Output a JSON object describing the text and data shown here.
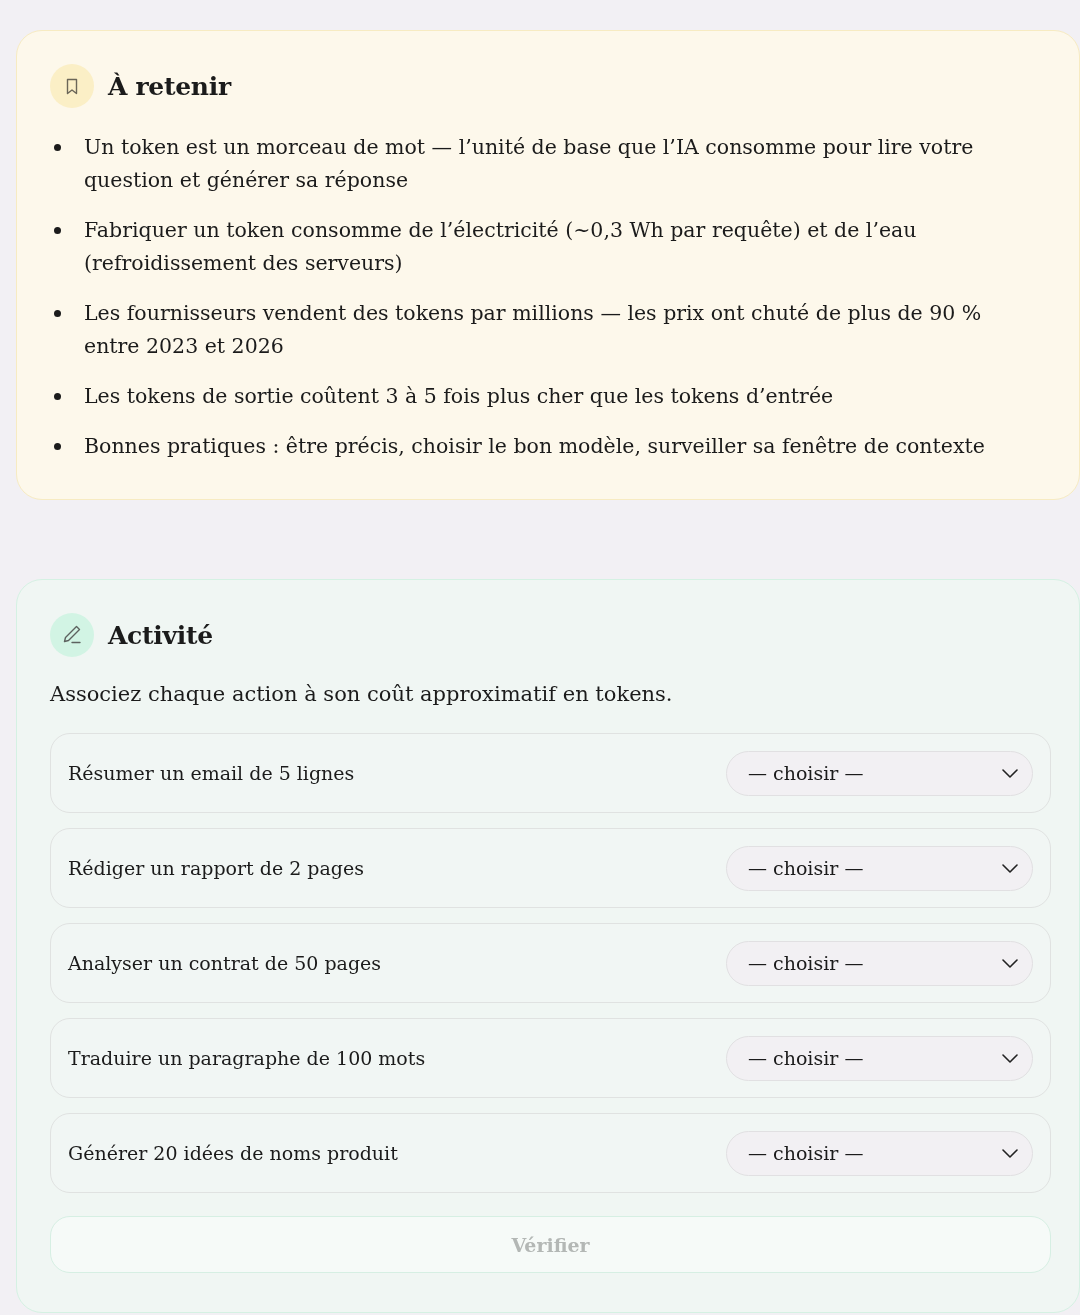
{
  "summary": {
    "title": "À retenir",
    "points": [
      "Un token est un morceau de mot — l’unité de base que l’IA consomme pour lire votre question et générer sa réponse",
      "Fabriquer un token consomme de l’électricité (~0,3 Wh par requête) et de l’eau (refroidissement des serveurs)",
      "Les fournisseurs vendent des tokens par millions — les prix ont chuté de plus de 90 % entre 2023 et 2026",
      "Les tokens de sortie coûtent 3 à 5 fois plus cher que les tokens d’entrée",
      "Bonnes pratiques : être précis, choisir le bon modèle, surveiller sa fenêtre de contexte"
    ]
  },
  "activity": {
    "title": "Activité",
    "instruction": "Associez chaque action à son coût approximatif en tokens.",
    "items": [
      {
        "action": "Résumer un email de 5 lignes",
        "choice": "— choisir —"
      },
      {
        "action": "Rédiger un rapport de 2 pages",
        "choice": "— choisir —"
      },
      {
        "action": "Analyser un contrat de 50 pages",
        "choice": "— choisir —"
      },
      {
        "action": "Traduire un paragraphe de 100 mots",
        "choice": "— choisir —"
      },
      {
        "action": "Générer 20 idées de noms produit",
        "choice": "— choisir —"
      }
    ],
    "verify_button": {
      "label": "Vérifier",
      "disabled": true
    }
  }
}
